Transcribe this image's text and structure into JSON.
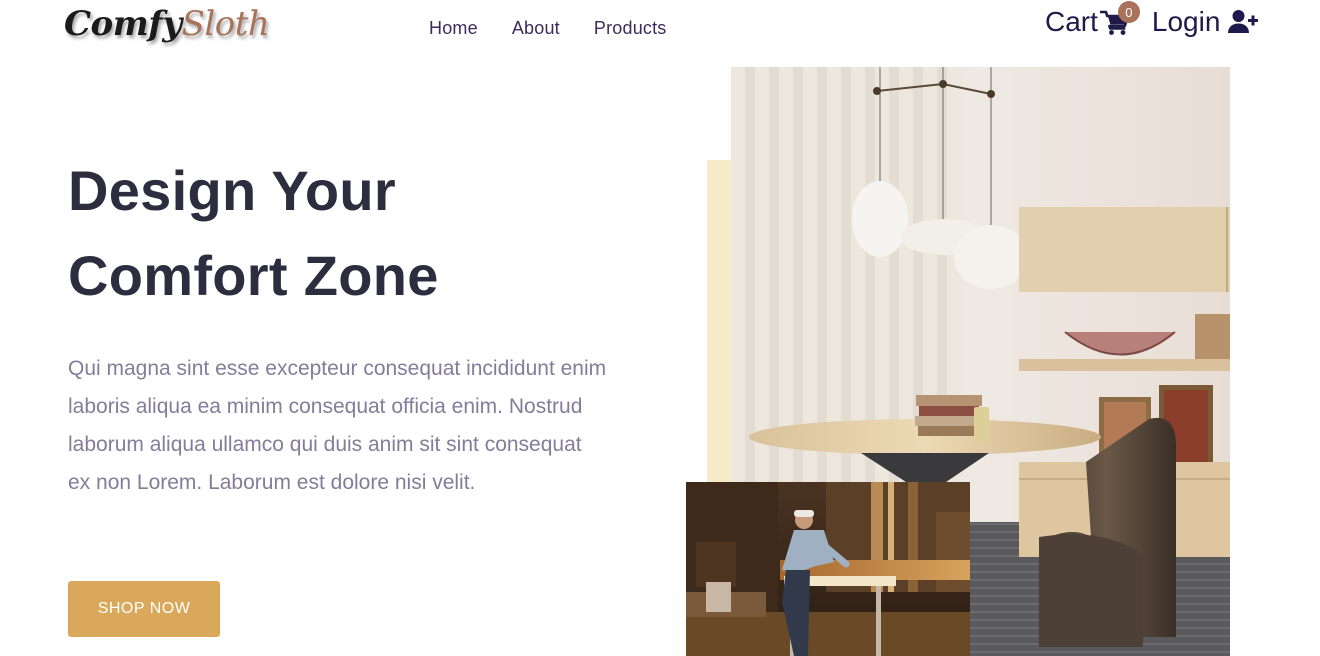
{
  "brand": {
    "logo_part1": "Comfy",
    "logo_part2": "Sloth"
  },
  "nav": {
    "links": [
      {
        "label": "Home"
      },
      {
        "label": "About"
      },
      {
        "label": "Products"
      }
    ],
    "cart_label": "Cart",
    "cart_count": "0",
    "login_label": "Login"
  },
  "hero": {
    "title_line1": "Design Your",
    "title_line2": "Comfort Zone",
    "description": "Qui magna sint esse excepteur consequat incididunt enim laboris aliqua ea minim consequat officia enim. Nostrud laborum aliqua ullamco qui duis anim sit sint consequat ex non Lorem. Laborum est dolore nisi velit.",
    "cta_label": "SHOP NOW"
  },
  "colors": {
    "accent": "#d9a85a",
    "brand_secondary": "#a8735a",
    "heading": "#2e2d3f",
    "body_text": "#837d99",
    "accent_bar": "#f6eac9"
  },
  "icons": {
    "cart": "cart-icon",
    "login": "user-plus-icon"
  }
}
